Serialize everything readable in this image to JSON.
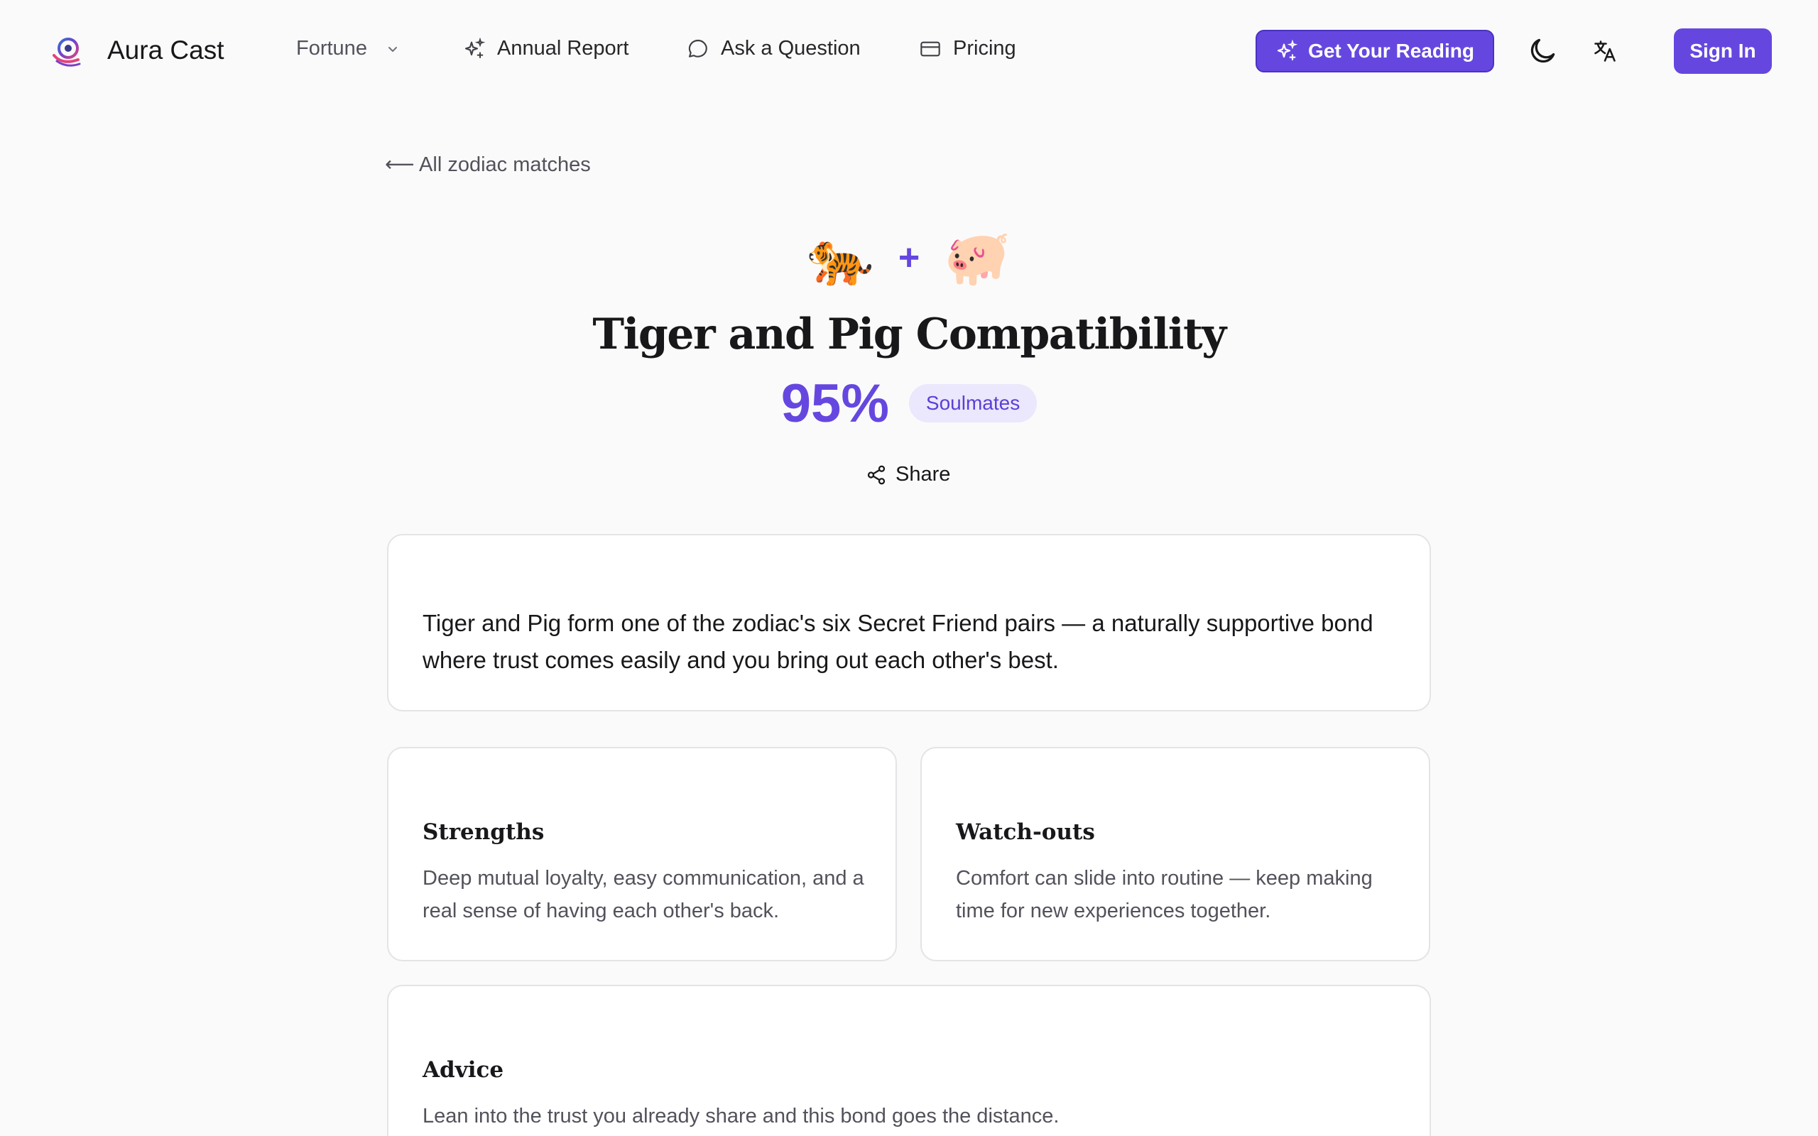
{
  "header": {
    "brand": "Aura Cast",
    "nav": {
      "fortune": "Fortune",
      "annual_report": "Annual Report",
      "ask_question": "Ask a Question",
      "pricing": "Pricing"
    },
    "cta_label": "Get Your Reading",
    "sign_in_label": "Sign In"
  },
  "main": {
    "back_link": "⟵ All zodiac matches",
    "animal_left": "🐅",
    "plus": "+",
    "animal_right": "🐖",
    "title": "Tiger and Pig Compatibility",
    "score": "95%",
    "badge": "Soulmates",
    "share_label": "Share",
    "intro": "Tiger and Pig form one of the zodiac's six Secret Friend pairs — a naturally supportive bond where trust comes easily and you bring out each other's best.",
    "strengths": {
      "title": "Strengths",
      "body": "Deep mutual loyalty, easy communication, and a real sense of having each other's back."
    },
    "watchouts": {
      "title": "Watch-outs",
      "body": "Comfort can slide into routine — keep making time for new experiences together."
    },
    "advice": {
      "title": "Advice",
      "body": "Lean into the trust you already share and this bond goes the distance."
    }
  },
  "colors": {
    "accent": "#6547e0",
    "badge_bg": "#ebe7fc",
    "page_bg": "#fafafa"
  },
  "icons": [
    "logo-icon",
    "chevron-down-icon",
    "sparkles-icon",
    "chat-bubble-icon",
    "credit-card-icon",
    "moon-icon",
    "translate-icon",
    "share-icon"
  ]
}
